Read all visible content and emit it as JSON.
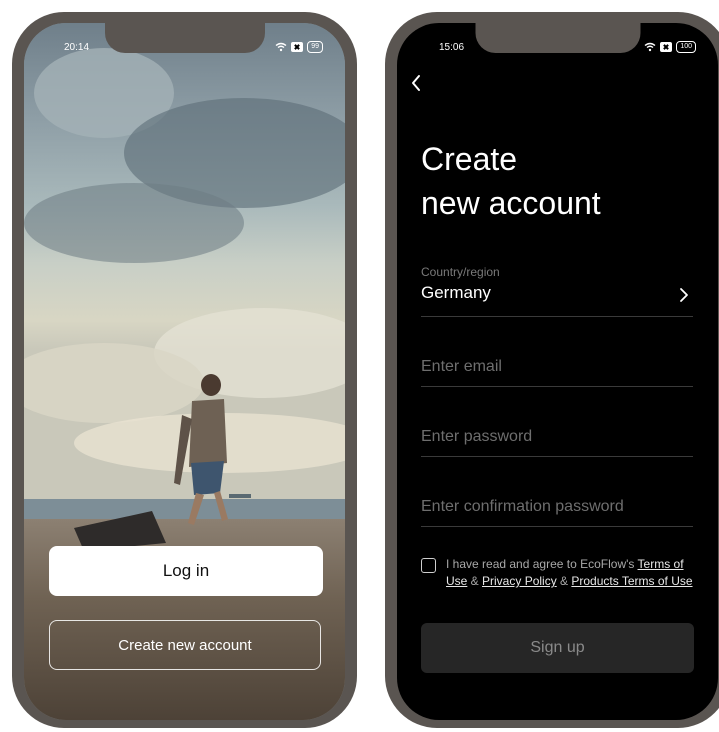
{
  "left_phone": {
    "status": {
      "time": "20:14",
      "battery": "99"
    },
    "buttons": {
      "login": "Log in",
      "create_account": "Create new account"
    }
  },
  "right_phone": {
    "status": {
      "time": "15:06",
      "battery": "100"
    },
    "title_line1": "Create",
    "title_line2": "new account",
    "country": {
      "label": "Country/region",
      "value": "Germany"
    },
    "email": {
      "placeholder": "Enter email",
      "value": ""
    },
    "password": {
      "placeholder": "Enter password",
      "value": ""
    },
    "confirm_password": {
      "placeholder": "Enter confirmation password",
      "value": ""
    },
    "agreement": {
      "prefix": "I have read and agree to EcoFlow's ",
      "terms": "Terms of Use",
      "sep1": " & ",
      "privacy": "Privacy Policy",
      "sep2": " & ",
      "products": "Products Terms of Use"
    },
    "signup_label": "Sign up"
  },
  "colors": {
    "frame": "#5a5551",
    "screen_dark": "#000000",
    "signup_bg": "#262626"
  }
}
